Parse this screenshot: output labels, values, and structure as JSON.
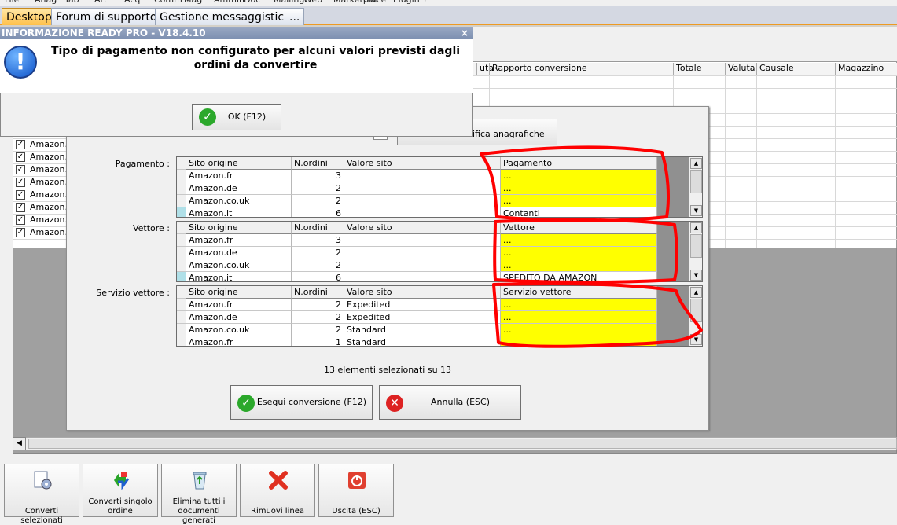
{
  "menu": [
    "File",
    "Anag",
    "Tab",
    "Art",
    "Acq",
    "Comm",
    "Mag",
    "Ammin",
    "Doc",
    "Mailing",
    "Web",
    "Marketplace",
    "Gui",
    "Plugin",
    "?"
  ],
  "tabs": [
    "Desktop",
    "Forum di supporto",
    "Gestione messaggistica",
    "..."
  ],
  "alert": {
    "title": "INFORMAZIONE READY PRO - V18.4.10",
    "close": "×",
    "message": "Tipo di pagamento non configurato per alcuni valori previsti dagli ordini da convertire",
    "ok_label": "OK (F12)"
  },
  "background": {
    "headers": [
      "uta",
      "Rapporto conversione",
      "Totale",
      "Valuta",
      "Causale",
      "Magazzino"
    ],
    "rows": [
      "Amazon.it",
      "Amazon.it",
      "Amazon.fr",
      "Amazon.c",
      "Amazon.it",
      "Amazon.it",
      "Amazon.it",
      "Amazon.it"
    ],
    "edit_label": "difica anagrafiche"
  },
  "dialog": {
    "sections": [
      {
        "label": "Pagamento :",
        "headers": [
          "Sito origine",
          "N.ordini",
          "Valore sito",
          "Pagamento"
        ],
        "rows": [
          {
            "sito": "Amazon.fr",
            "n": "3",
            "valore": "",
            "mapped": "...",
            "yellow": true
          },
          {
            "sito": "Amazon.de",
            "n": "2",
            "valore": "",
            "mapped": "...",
            "yellow": true
          },
          {
            "sito": "Amazon.co.uk",
            "n": "2",
            "valore": "",
            "mapped": "...",
            "yellow": true
          },
          {
            "sito": "Amazon.it",
            "n": "6",
            "valore": "",
            "mapped": "Contanti",
            "yellow": false
          }
        ]
      },
      {
        "label": "Vettore :",
        "headers": [
          "Sito origine",
          "N.ordini",
          "Valore sito",
          "Vettore"
        ],
        "rows": [
          {
            "sito": "Amazon.fr",
            "n": "3",
            "valore": "",
            "mapped": "...",
            "yellow": true
          },
          {
            "sito": "Amazon.de",
            "n": "2",
            "valore": "",
            "mapped": "...",
            "yellow": true
          },
          {
            "sito": "Amazon.co.uk",
            "n": "2",
            "valore": "",
            "mapped": "...",
            "yellow": true
          },
          {
            "sito": "Amazon.it",
            "n": "6",
            "valore": "",
            "mapped": "SPEDITO DA AMAZON",
            "yellow": false
          }
        ]
      },
      {
        "label": "Servizio vettore :",
        "headers": [
          "Sito origine",
          "N.ordini",
          "Valore sito",
          "Servizio vettore"
        ],
        "rows": [
          {
            "sito": "Amazon.fr",
            "n": "2",
            "valore": "Expedited",
            "mapped": "...",
            "yellow": true
          },
          {
            "sito": "Amazon.de",
            "n": "2",
            "valore": "Expedited",
            "mapped": "...",
            "yellow": true
          },
          {
            "sito": "Amazon.co.uk",
            "n": "2",
            "valore": "Standard",
            "mapped": "...",
            "yellow": true
          },
          {
            "sito": "Amazon.fr",
            "n": "1",
            "valore": "Standard",
            "mapped": "...",
            "yellow": true
          }
        ]
      }
    ],
    "selection_status": "13 elementi selezionati su 13",
    "run_label": "Esegui conversione (F12)",
    "cancel_label": "Annulla (ESC)"
  },
  "toolbar": [
    {
      "label": "Converti selezionati",
      "icon": "convert-selected-icon"
    },
    {
      "label": "Converti singolo ordine",
      "icon": "convert-single-icon"
    },
    {
      "label": "Elimina tutti i documenti generati",
      "icon": "recycle-bin-icon"
    },
    {
      "label": "Rimuovi linea",
      "icon": "red-x-icon"
    },
    {
      "label": "Uscita (ESC)",
      "icon": "exit-icon"
    }
  ],
  "colors": {
    "highlight": "#ffff00",
    "annotation": "#ff0000",
    "ok_green": "#22aa22",
    "cancel_red": "#dd2222"
  }
}
